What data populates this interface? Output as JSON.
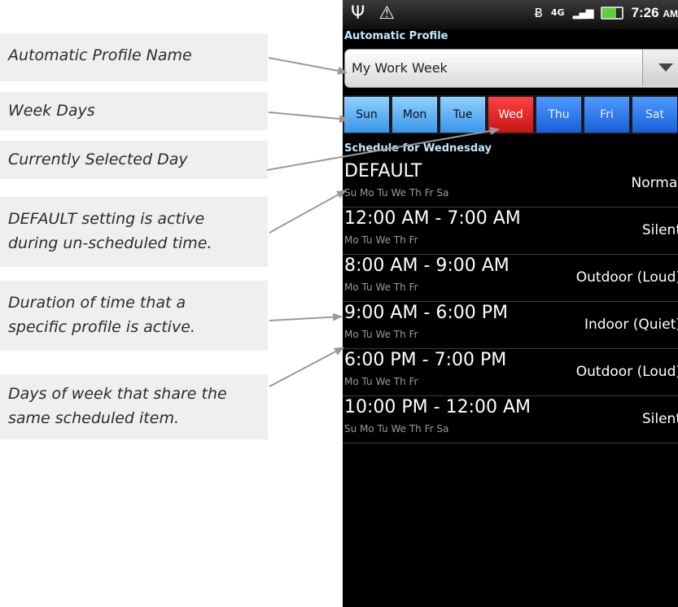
{
  "callouts": [
    {
      "line1": "Automatic Profile Name"
    },
    {
      "line1": "Week Days"
    },
    {
      "line1": "Currently Selected Day"
    },
    {
      "line1": "DEFAULT setting is active",
      "line2": "during un-scheduled time."
    },
    {
      "line1": "Duration of time that a",
      "line2": "specific profile is active."
    },
    {
      "line1": "Days of week that share the",
      "line2": "same scheduled item."
    }
  ],
  "statusbar": {
    "left_icons": [
      "usb-icon",
      "warning-icon"
    ],
    "right_icons": [
      "bluetooth-icon",
      "network-4g-icon",
      "signal-icon",
      "battery-icon"
    ],
    "network": "4G",
    "time": "7:26",
    "ampm": "AM"
  },
  "app": {
    "title": "Automatic Profile",
    "profile_name": "My Work Week",
    "days": [
      "Sun",
      "Mon",
      "Tue",
      "Wed",
      "Thu",
      "Fri",
      "Sat"
    ],
    "selected_day": "Wed",
    "schedule_title": "Schedule for Wednesday",
    "schedule": [
      {
        "time": "DEFAULT",
        "days": "Su Mo Tu We Th Fr Sa",
        "profile": "Normal"
      },
      {
        "time": "12:00 AM - 7:00 AM",
        "days": "Mo Tu We Th Fr",
        "profile": "Silent"
      },
      {
        "time": "8:00 AM - 9:00 AM",
        "days": "Mo Tu We Th Fr",
        "profile": "Outdoor (Loud)"
      },
      {
        "time": "9:00 AM - 6:00 PM",
        "days": "Mo Tu We Th Fr",
        "profile": "Indoor (Quiet)"
      },
      {
        "time": "6:00 PM - 7:00 PM",
        "days": "Mo Tu We Th Fr",
        "profile": "Outdoor (Loud)"
      },
      {
        "time": "10:00 PM - 12:00 AM",
        "days": "Su Mo Tu We Th Fr Sa",
        "profile": "Silent"
      }
    ]
  },
  "colors": {
    "selected_day": "#d81f1f",
    "day_button": "#5aaaf0",
    "header_text": "#bfe9ff"
  }
}
